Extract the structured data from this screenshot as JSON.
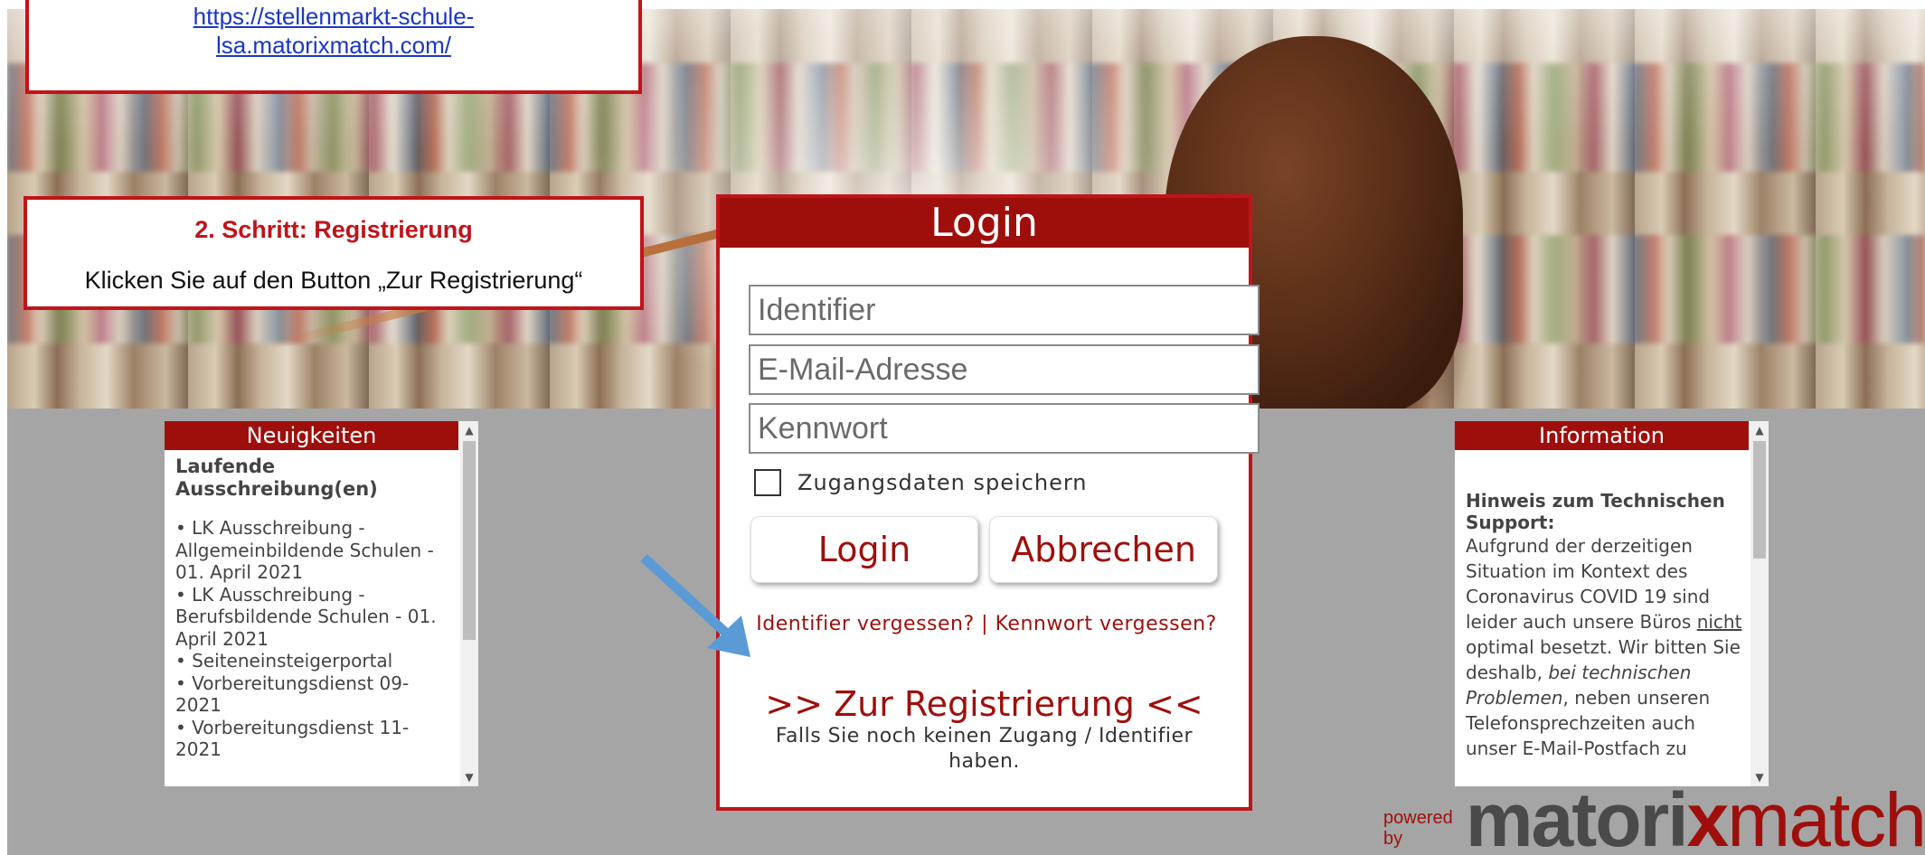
{
  "callouts": {
    "url": "https://stellenmarkt-schule-lsa.matorixmatch.com/",
    "url_line1": "https://stellenmarkt-schule-",
    "url_line2": "lsa.matorixmatch.com/",
    "step_title": "2. Schritt: Registrierung",
    "step_text": "Klicken Sie auf den Button „Zur Registrierung“"
  },
  "login": {
    "title": "Login",
    "identifier_placeholder": "Identifier",
    "email_placeholder": "E-Mail-Adresse",
    "password_placeholder": "Kennwort",
    "remember_label": "Zugangsdaten speichern",
    "login_button": "Login",
    "cancel_button": "Abbrechen",
    "forgot_identifier": "Identifier vergessen?",
    "separator": "|",
    "forgot_password": "Kennwort vergessen?",
    "register_link": ">> Zur Registrierung <<",
    "register_hint": "Falls Sie noch keinen Zugang / Identifier haben."
  },
  "news": {
    "header": "Neuigkeiten",
    "title": "Laufende Ausschreibung(en)",
    "items": [
      "• LK Ausschreibung - Allgemeinbildende Schulen - 01. April 2021",
      "• LK Ausschreibung - Berufsbildende Schulen - 01. April 2021",
      "• Seiteneinsteigerportal",
      "• Vorbereitungsdienst 09-2021",
      "• Vorbereitungsdienst 11-2021"
    ]
  },
  "info": {
    "header": "Information",
    "title": "Hinweis zum Technischen Support:",
    "text_part1": "Aufgrund der derzeitigen Situation im Kontext des Coronavirus COVID 19 sind leider auch unsere Büros ",
    "text_underlined": "nicht",
    "text_part2": " optimal besetzt. Wir bitten Sie deshalb, ",
    "text_italic": "bei technischen Problemen",
    "text_part3": ", neben unseren Telefonsprechzeiten auch unser E-Mail-Postfach zu"
  },
  "brand": {
    "powered_by": "powered by",
    "logo_part1": "matori",
    "logo_x": "x",
    "logo_part2": "match"
  },
  "icons": {
    "scroll_up": "▲",
    "scroll_down": "▼",
    "arrow": "arrow-down-right-icon"
  },
  "colors": {
    "accent": "#9e0f0c",
    "callout_border": "#c0141a",
    "link": "#1a37c4",
    "arrow": "#5b9bd5",
    "background_grey": "#a5a5a5"
  }
}
